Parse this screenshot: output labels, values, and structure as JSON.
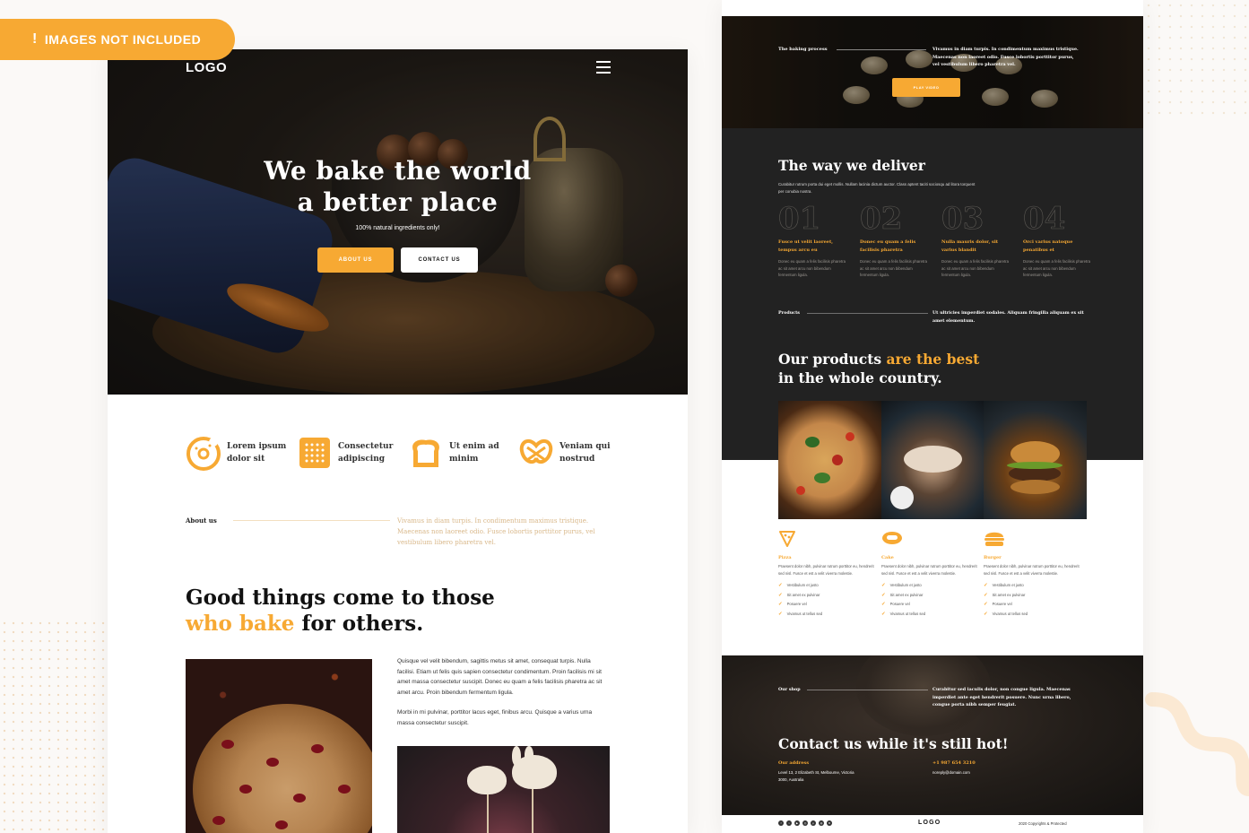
{
  "badge": {
    "text": "IMAGES NOT INCLUDED",
    "icon": "exclamation-icon"
  },
  "colors": {
    "accent": "#f7a933",
    "dark": "#222222",
    "light_bg": "#fbf9f7"
  },
  "left_page": {
    "header": {
      "logo": "LOGO",
      "menu_icon": "hamburger-menu-icon"
    },
    "hero": {
      "title_line1": "We bake the world",
      "title_line2": "a better place",
      "tagline": "100% natural ingredients only!",
      "about_button": "ABOUT US",
      "contact_button": "CONTACT US"
    },
    "features": [
      {
        "icon": "donut-icon",
        "line1": "Lorem ipsum",
        "line2": "dolor sit"
      },
      {
        "icon": "cracker-icon",
        "line1": "Consectetur",
        "line2": "adipiscing"
      },
      {
        "icon": "bread-icon",
        "line1": "Ut enim ad",
        "line2": "minim"
      },
      {
        "icon": "pretzel-icon",
        "line1": "Veniam qui",
        "line2": "nostrud"
      }
    ],
    "about": {
      "label": "About us",
      "text": "Vivamus in diam turpis. In condimentum maximus tristique. Maecenas non laoreet odio. Fusce lobortis porttitor purus, vel vestibulum libero pharetra vel."
    },
    "good_things": {
      "line1": "Good things come to those",
      "accent": "who bake",
      "rest": " for others."
    },
    "paragraph1": "Quisque vel velit bibendum, sagittis metus sit amet, consequat turpis. Nulla facilisi. Etiam ut felis quis sapien consectetur condimentum. Proin facilisis mi sit amet massa consectetur suscipit. Donec eu quam a felis facilisis pharetra ac sit amet arcu. Proin bibendum fermentum ligula.",
    "paragraph2": "Morbi in mi pulvinar, porttitor lacus eget, finibus arcu. Quisque a varius urna massa consectetur suscipit."
  },
  "right_page": {
    "video": {
      "label": "The baking process",
      "text": "Vivamus in diam turpis. In condimentum maximus tristique. Maecenas non laoreet odio. Fusce lobortis porttitor purus, vel vestibulum libero pharetra vel.",
      "play_button": "PLAY VIDEO"
    },
    "deliver": {
      "title": "The way we deliver",
      "subtitle": "Curabitur rutrum porta dui eget mollis. Nullam lacinia dictum auctor. Class aptent taciti sociosqu ad litora torquent per conubia nostra.",
      "steps": [
        {
          "num": "01",
          "title": "Fusce ut velit laoreet, tempus arcu eu",
          "desc": "Donec eu quam a felis facilisis pharetra ac sit amet arcu non bibendum fermentum ligula."
        },
        {
          "num": "02",
          "title": "Donec eu quam a felis facilisis pharetra",
          "desc": "Donec eu quam a felis facilisis pharetra ac sit amet arcu non bibendum fermentum ligula."
        },
        {
          "num": "03",
          "title": "Nulla mauris dolor, sit varius blandit",
          "desc": "Donec eu quam a felis facilisis pharetra ac sit amet arcu non bibendum fermentum ligula."
        },
        {
          "num": "04",
          "title": "Orci varius natoque penatibus et",
          "desc": "Donec eu quam a felis facilisis pharetra ac sit amet arcu non bibendum fermentum ligula."
        }
      ]
    },
    "products": {
      "label": "Products",
      "text": "Ut ultricies imperdiet sodales. Aliquam fringilla aliquam ex sit amet elementum.",
      "title_line1_start": "Our products ",
      "title_accent": "are the best",
      "title_line2": "in the whole country.",
      "categories": [
        {
          "icon": "pizza-icon",
          "name": "Pizza",
          "desc": "Praesent dolor nibh, pulvinar rutrum porttitor eu, hendrerit sed nisl. Fusce et est a velit viverra molestie.",
          "items": [
            "Vestibulum et justo",
            "Sit amet ex pulvinar",
            "Posuere vel",
            "Vivamus ut tellus sed"
          ]
        },
        {
          "icon": "cake-icon",
          "name": "Cake",
          "desc": "Praesent dolor nibh, pulvinar rutrum porttitor eu, hendrerit sed nisl. Fusce et est a velit viverra molestie.",
          "items": [
            "Vestibulum et justo",
            "Sit amet ex pulvinar",
            "Posuere vel",
            "Vivamus ut tellus sed"
          ]
        },
        {
          "icon": "burger-icon",
          "name": "Burger",
          "desc": "Praesent dolor nibh, pulvinar rutrum porttitor eu, hendrerit sed nisl. Fusce et est a velit viverra molestie.",
          "items": [
            "Vestibulum et justo",
            "Sit amet ex pulvinar",
            "Posuere vel",
            "Vivamus ut tellus sed"
          ]
        }
      ]
    },
    "contact": {
      "label": "Our shop",
      "text": "Curabitur sed iaculis dolor, non congue ligula. Maecenas imperdiet ante eget hendrerit posuere. Nunc urna libero, congue porta nibh semper feugiat.",
      "title": "Contact us while it's still hot!",
      "address_label": "Our address",
      "address": "Level 13, 2 Elizabeth St, Melbourne, Victoria 3000, Australia",
      "phone": "+1 987 654 3210",
      "email": "noreply@domain.com"
    },
    "footer": {
      "social_icons": [
        "facebook-icon",
        "twitter-icon",
        "youtube-icon",
        "instagram-icon",
        "pinterest-icon",
        "dribbble-icon",
        "behance-icon"
      ],
      "logo": "LOGO",
      "copyright": "2020 Copyrights & Protected"
    }
  }
}
